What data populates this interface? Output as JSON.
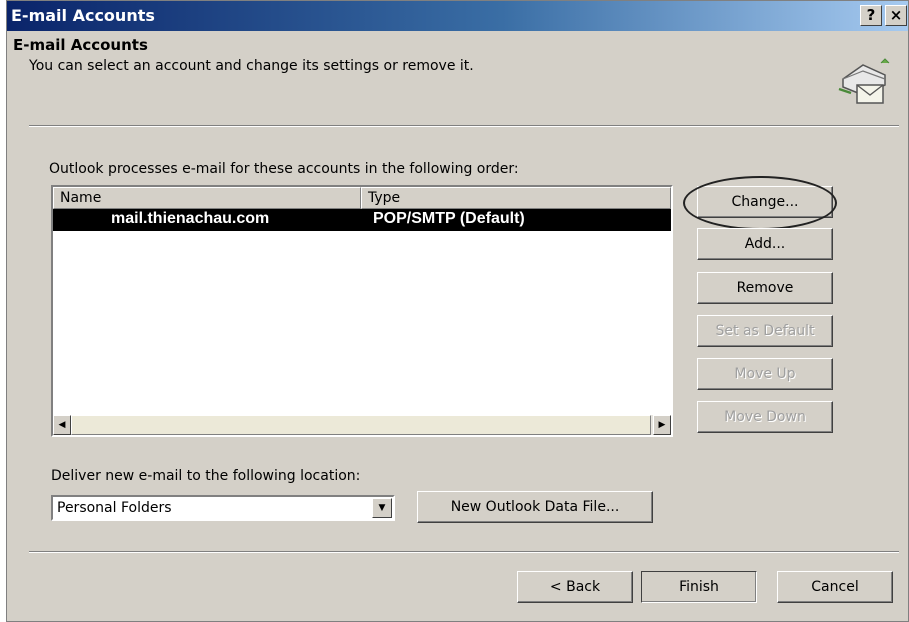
{
  "window": {
    "title": "E-mail Accounts",
    "help_label": "?",
    "close_label": "×"
  },
  "header": {
    "title": "E-mail Accounts",
    "subtitle": "You can select an account and change its settings or remove it."
  },
  "accounts": {
    "label": "Outlook processes e-mail for these accounts in the following order:",
    "columns": [
      "Name",
      "Type"
    ],
    "rows": [
      {
        "name": "mail.thienachau.com",
        "type": "POP/SMTP (Default)",
        "selected": true
      }
    ]
  },
  "side_buttons": [
    {
      "label": "Change...",
      "enabled": true,
      "highlighted": true
    },
    {
      "label": "Add...",
      "enabled": true
    },
    {
      "label": "Remove",
      "enabled": true
    },
    {
      "label": "Set as Default",
      "enabled": false
    },
    {
      "label": "Move Up",
      "enabled": false
    },
    {
      "label": "Move Down",
      "enabled": false
    }
  ],
  "delivery": {
    "label": "Deliver new e-mail to the following location:",
    "selected": "Personal Folders",
    "new_file_label": "New Outlook Data File..."
  },
  "footer": {
    "back_label": "< Back",
    "finish_label": "Finish",
    "cancel_label": "Cancel"
  },
  "colors": {
    "dialog_bg": "#d4d0c8",
    "title_gradient_start": "#0a246a",
    "title_gradient_end": "#a6caf0",
    "selection_bg": "#000000"
  }
}
